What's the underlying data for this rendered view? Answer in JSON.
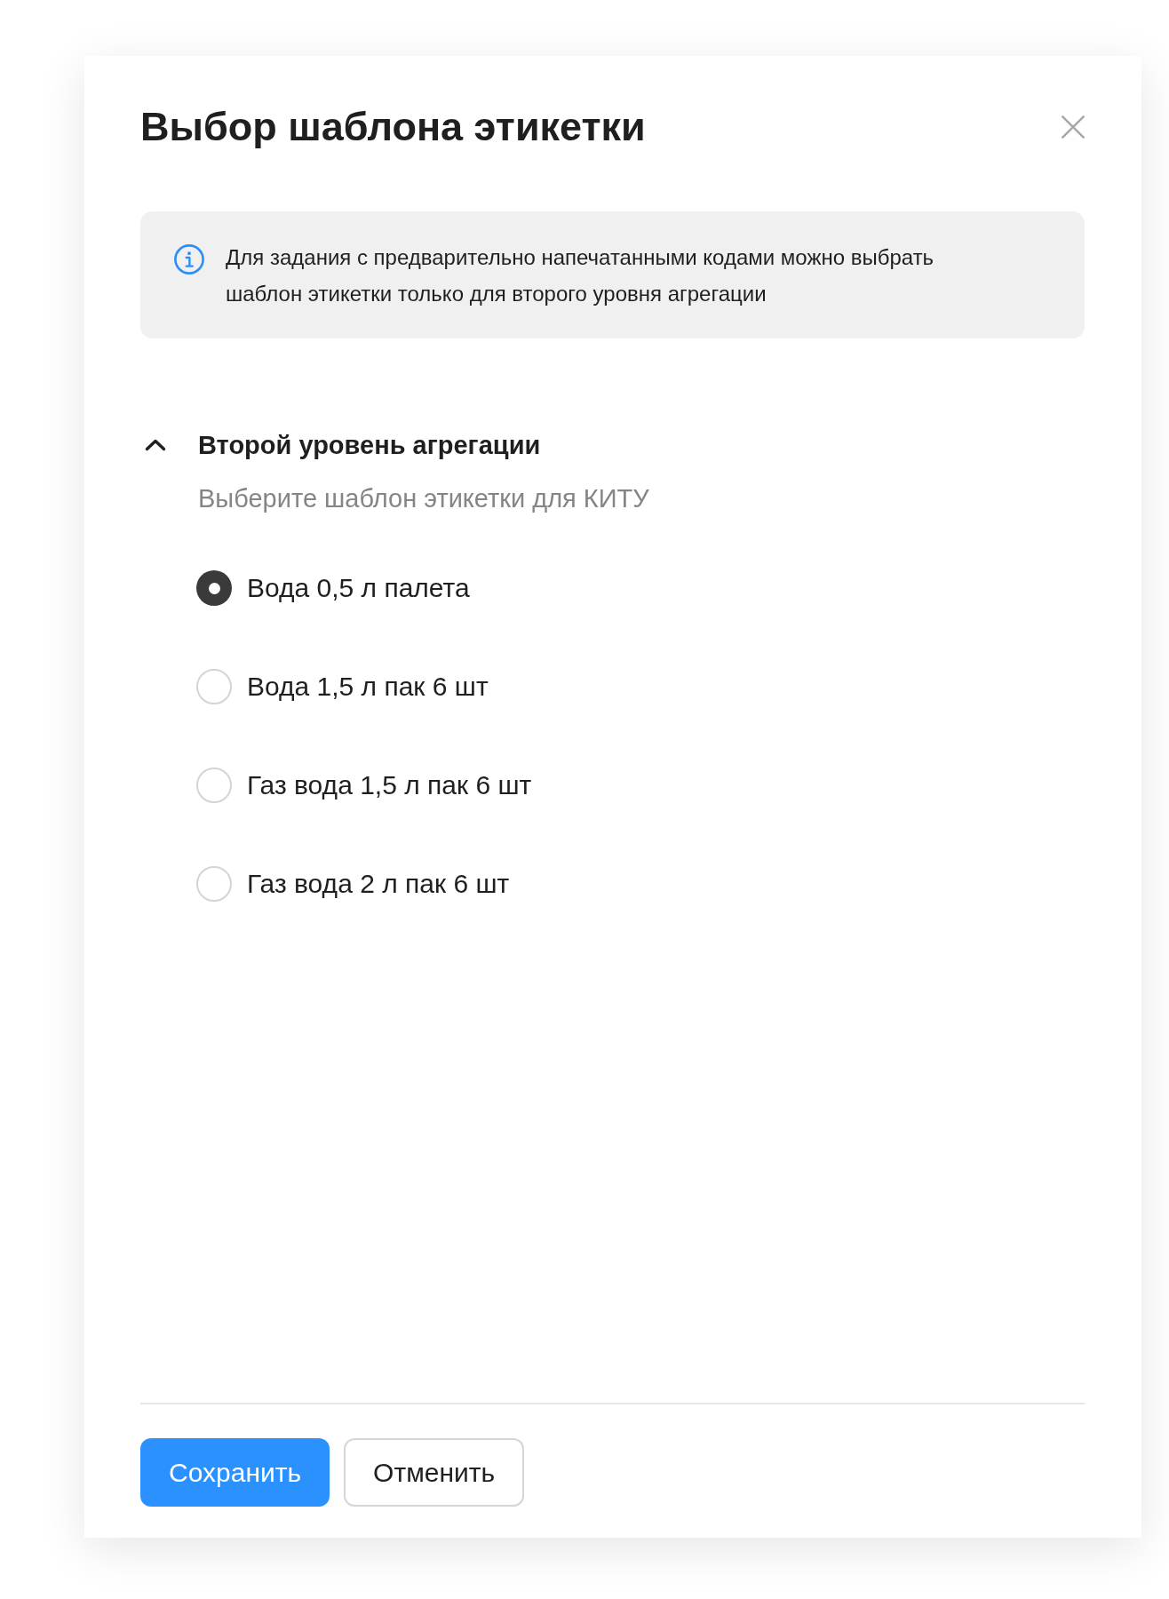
{
  "dialog": {
    "title": "Выбор шаблона этикетки"
  },
  "notice": {
    "text": "Для задания с предварительно напечатанными кодами можно выбрать шаблон этикетки только для второго уровня агрегации"
  },
  "section": {
    "title": "Второй уровень агрегации",
    "expanded": true,
    "subtitle": "Выберите шаблон этикетки для КИТУ",
    "options": [
      {
        "label": "Вода 0,5 л палета",
        "selected": true
      },
      {
        "label": "Вода 1,5 л пак 6 шт",
        "selected": false
      },
      {
        "label": "Газ вода 1,5 л пак 6 шт",
        "selected": false
      },
      {
        "label": "Газ вода 2 л пак 6 шт",
        "selected": false
      }
    ]
  },
  "buttons": [
    {
      "label": "Сохранить",
      "kind": "primary"
    },
    {
      "label": "Отменить",
      "kind": "secondary"
    }
  ]
}
